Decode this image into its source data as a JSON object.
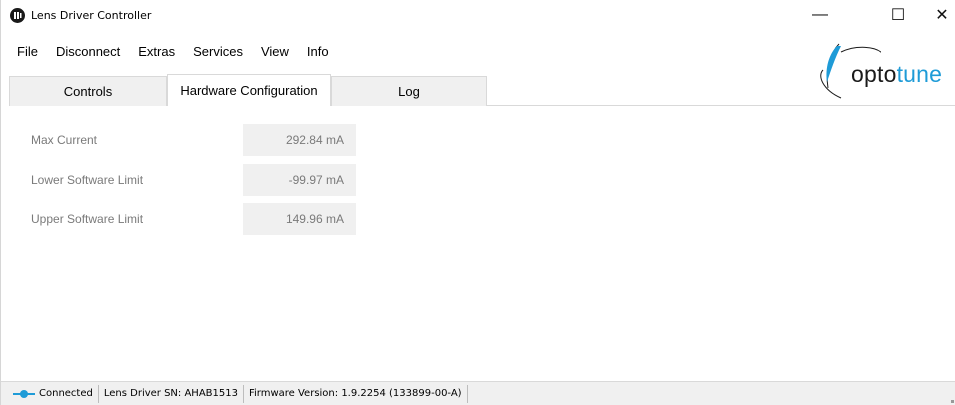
{
  "window": {
    "title": "Lens Driver Controller",
    "icon": "lens-app-icon",
    "controls": {
      "minimize": "—",
      "maximize": "☐",
      "close": "✕"
    }
  },
  "menu": {
    "items": [
      "File",
      "Disconnect",
      "Extras",
      "Services",
      "View",
      "Info"
    ]
  },
  "logo": {
    "text_main": "opto",
    "text_accent": "tune",
    "accent_color": "#1e9bd7"
  },
  "tabs": [
    {
      "label": "Controls",
      "active": false
    },
    {
      "label": "Hardware Configuration",
      "active": true
    },
    {
      "label": "Log",
      "active": false
    }
  ],
  "hardware_config": {
    "rows": [
      {
        "label": "Max Current",
        "value": "292.84 mA"
      },
      {
        "label": "Lower Software Limit",
        "value": "-99.97 mA"
      },
      {
        "label": "Upper Software Limit",
        "value": "149.96 mA"
      }
    ]
  },
  "statusbar": {
    "connection": "Connected",
    "serial": "Lens Driver SN: AHAB1513",
    "firmware": "Firmware Version: 1.9.2254 (133899-00-A)",
    "connection_icon": "connected-plug-icon",
    "connection_color": "#1e9bd7"
  }
}
